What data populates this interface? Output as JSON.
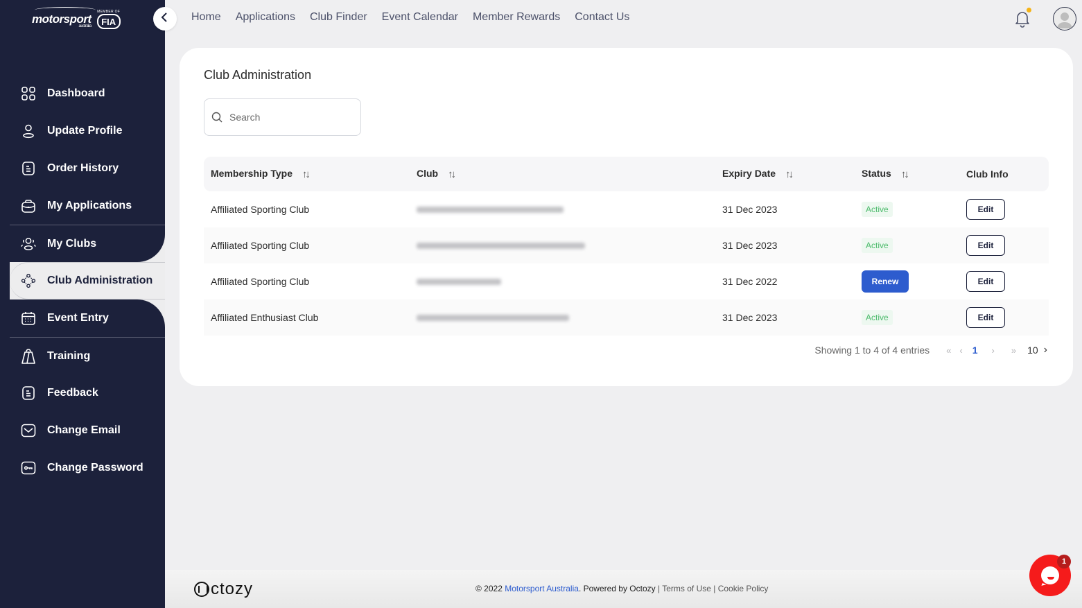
{
  "brand": {
    "logo_text": "motorsport",
    "logo_subtext": "australia",
    "member_text": "MEMBER OF",
    "fia_text": "FIA"
  },
  "topnav": {
    "links": [
      "Home",
      "Applications",
      "Club Finder",
      "Event Calendar",
      "Member Rewards",
      "Contact Us"
    ],
    "notification_dot_color": "#f5b316"
  },
  "sidebar": {
    "items": [
      {
        "label": "Dashboard",
        "icon": "grid-icon"
      },
      {
        "label": "Update Profile",
        "icon": "user-icon"
      },
      {
        "label": "Order History",
        "icon": "document-icon"
      },
      {
        "label": "My Applications",
        "icon": "briefcase-icon"
      },
      {
        "label": "My Clubs",
        "icon": "users-icon"
      },
      {
        "label": "Club Administration",
        "icon": "network-icon",
        "active": true
      },
      {
        "label": "Event Entry",
        "icon": "calendar-icon"
      },
      {
        "label": "Training",
        "icon": "bag-icon"
      },
      {
        "label": "Feedback",
        "icon": "document-icon"
      },
      {
        "label": "Change Email",
        "icon": "mail-icon"
      },
      {
        "label": "Change Password",
        "icon": "key-icon"
      }
    ]
  },
  "main": {
    "title": "Club Administration",
    "search": {
      "placeholder": "Search",
      "value": ""
    },
    "table": {
      "columns": [
        "Membership Type",
        "Club",
        "Expiry Date",
        "Status",
        "Club Info"
      ],
      "rows": [
        {
          "membership_type": "Affiliated Sporting Club",
          "club": "[blurred]",
          "expiry": "31 Dec 2023",
          "status": "Active",
          "action": "Edit"
        },
        {
          "membership_type": "Affiliated Sporting Club",
          "club": "[blurred]",
          "expiry": "31 Dec 2023",
          "status": "Active",
          "action": "Edit"
        },
        {
          "membership_type": "Affiliated Sporting Club",
          "club": "[blurred]",
          "expiry": "31 Dec 2022",
          "status": "Renew",
          "action": "Edit"
        },
        {
          "membership_type": "Affiliated Enthusiast Club",
          "club": "[blurred]",
          "expiry": "31 Dec 2023",
          "status": "Active",
          "action": "Edit"
        }
      ]
    },
    "pagination": {
      "info": "Showing 1 to 4 of 4 entries",
      "first": "«",
      "prev": "‹",
      "current_page": "1",
      "next": "›",
      "last": "»",
      "page_size": "10",
      "page_size_toggle": "›"
    }
  },
  "footer": {
    "logo": "ctozy",
    "copyright_prefix": "© 2022 ",
    "org_link": "Motorsport Australia",
    "powered_by": ". Powered by Octozy",
    "sep": " | ",
    "terms": "Terms of Use",
    "cookie": "Cookie Policy"
  },
  "chat": {
    "unread_count": "1"
  },
  "colors": {
    "sidebar_bg": "#1c213b",
    "accent_blue": "#2d5cce",
    "active_green": "#4cbb6b",
    "chat_red": "#f51b1b"
  }
}
